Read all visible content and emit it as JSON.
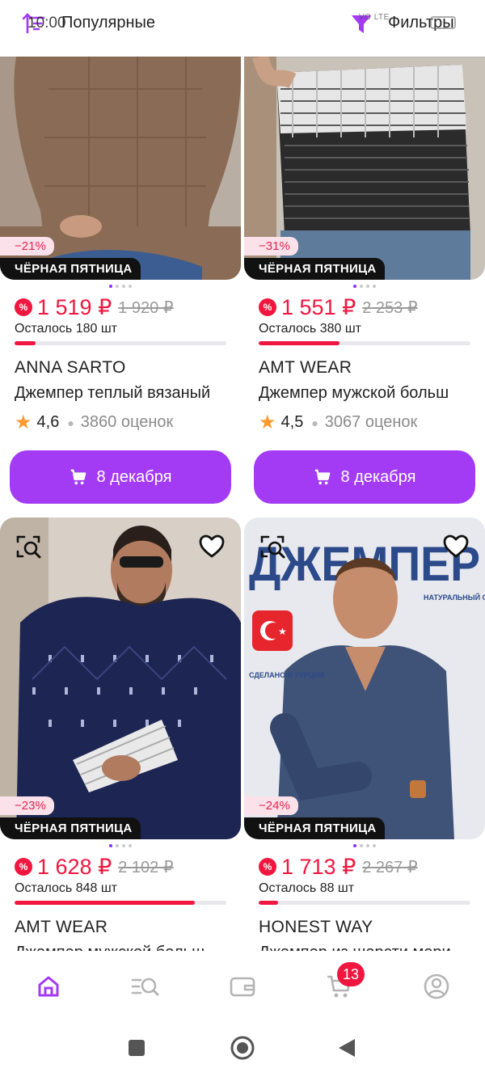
{
  "status": {
    "time": "10:00",
    "net": "VO LTE",
    "signal": "46",
    "battery": ""
  },
  "topbar": {
    "sort_label": "Популярные",
    "filter_label": "Фильтры"
  },
  "colors": {
    "accent": "#a33bf5",
    "price": "#f0163f",
    "star": "#ff9a2e"
  },
  "products": [
    {
      "discount": "−21%",
      "promo": "ЧЁРНАЯ ПЯТНИЦА",
      "price": "1 519 ₽",
      "old_price": "1 920 ₽",
      "stock": "Осталось 180 шт",
      "stock_fill": 0.1,
      "brand": "ANNA SARTO",
      "name": "Джемпер теплый вязаный",
      "rating": "4,6",
      "reviews": "3860 оценок",
      "cart_label": "8 декабря"
    },
    {
      "discount": "−31%",
      "promo": "ЧЁРНАЯ ПЯТНИЦА",
      "price": "1 551 ₽",
      "old_price": "2 253 ₽",
      "stock": "Осталось 380 шт",
      "stock_fill": 0.38,
      "brand": "AMT WEAR",
      "name": "Джемпер мужской больш",
      "rating": "4,5",
      "reviews": "3067 оценок",
      "cart_label": "8 декабря"
    },
    {
      "discount": "−23%",
      "promo": "ЧЁРНАЯ ПЯТНИЦА",
      "price": "1 628 ₽",
      "old_price": "2 102 ₽",
      "stock": "Осталось 848 шт",
      "stock_fill": 0.85,
      "brand": "AMT WEAR",
      "name": "Джемпер мужской больш"
    },
    {
      "discount": "−24%",
      "promo": "ЧЁРНАЯ ПЯТНИЦА",
      "price": "1 713 ₽",
      "old_price": "2 267 ₽",
      "stock": "Осталось 88 шт",
      "stock_fill": 0.09,
      "brand": "HONEST WAY",
      "name": "Джемпер из шерсти мери",
      "image_text": {
        "headline": "ДЖЕМПЕР",
        "side": "НАТУРАЛЬНЫЙ СОСТАВ",
        "made": "СДЕЛАНО В ТУРЦИИ"
      }
    }
  ],
  "bottom_nav": {
    "cart_badge": "13",
    "items": [
      "home-icon",
      "catalog-search-icon",
      "wallet-icon",
      "cart-icon",
      "profile-icon"
    ]
  }
}
